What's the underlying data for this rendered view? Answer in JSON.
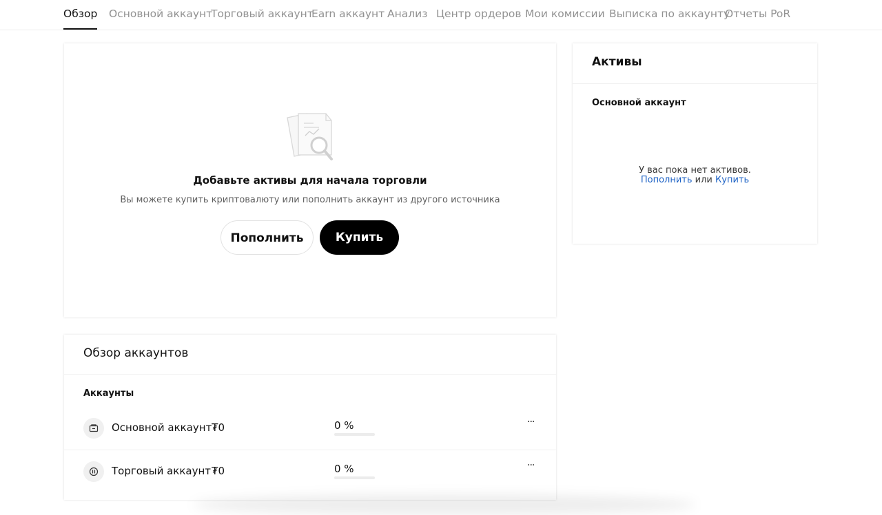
{
  "tabs": [
    {
      "label": "Обзор",
      "active": true
    },
    {
      "label": "Основной аккаунт"
    },
    {
      "label": "Торговый аккаунт"
    },
    {
      "label": "Earn аккаунт"
    },
    {
      "label": "Анализ"
    },
    {
      "label": "Центр ордеров"
    },
    {
      "label": "Мои комиссии"
    },
    {
      "label": "Выписка по аккаунту"
    },
    {
      "label": "Отчеты PoR"
    }
  ],
  "hero": {
    "title": "Добавьте активы для начала торговли",
    "subtitle": "Вы можете купить криптовалюту или пополнить аккаунт из другого источника",
    "deposit_label": "Пополнить",
    "buy_label": "Купить",
    "illustration_icon": "document-search-icon"
  },
  "assets": {
    "title": "Активы",
    "account_label": "Основной аккаунт",
    "empty_text": "У вас пока нет активов.",
    "deposit_link": "Пополнить",
    "or_text": "или",
    "buy_link": "Купить"
  },
  "accounts_overview": {
    "title": "Обзор аккаунтов",
    "column_label": "Аккаунты",
    "rows": [
      {
        "name": "Основной аккаунт",
        "balance": "₮0",
        "percent": "0 %",
        "percent_value": 0,
        "icon": "wallet-icon",
        "more": "···"
      },
      {
        "name": "Торговый аккаунт",
        "balance": "₮0",
        "percent": "0 %",
        "percent_value": 0,
        "icon": "trading-icon",
        "more": "···"
      }
    ]
  },
  "colors": {
    "link": "#1d62c5",
    "primary_button": "#000000",
    "tab_inactive": "#929292"
  }
}
